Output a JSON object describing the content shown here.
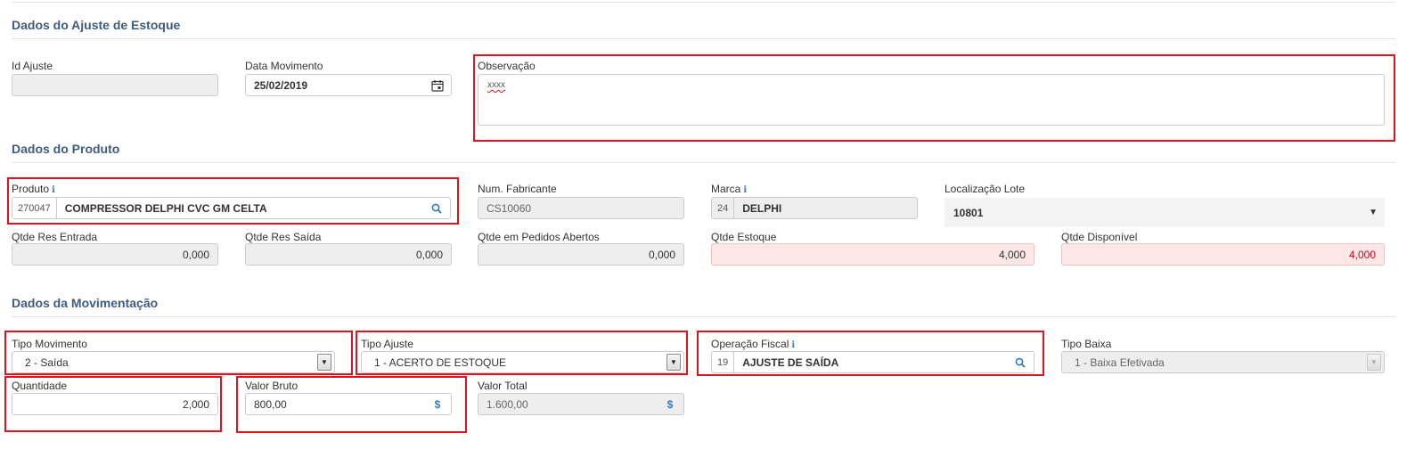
{
  "sections": {
    "ajuste_title": "Dados do Ajuste de Estoque",
    "produto_title": "Dados do Produto",
    "movimentacao_title": "Dados da Movimentação"
  },
  "ajuste": {
    "id_label": "Id Ajuste",
    "id_value": "",
    "data_label": "Data Movimento",
    "data_value": "25/02/2019",
    "obs_label": "Observação",
    "obs_value": "xxxx"
  },
  "produto": {
    "produto_label": "Produto",
    "produto_code": "270047",
    "produto_name": "COMPRESSOR DELPHI CVC GM CELTA",
    "fabricante_label": "Num. Fabricante",
    "fabricante_value": "CS10060",
    "marca_label": "Marca",
    "marca_code": "24",
    "marca_name": "DELPHI",
    "lote_label": "Localização Lote",
    "lote_value": "10801",
    "res_entrada_label": "Qtde Res Entrada",
    "res_entrada_value": "0,000",
    "res_saida_label": "Qtde Res Saída",
    "res_saida_value": "0,000",
    "pedidos_label": "Qtde em Pedidos Abertos",
    "pedidos_value": "0,000",
    "estoque_label": "Qtde Estoque",
    "estoque_value": "4,000",
    "disponivel_label": "Qtde Disponível",
    "disponivel_value": "4,000"
  },
  "movimentacao": {
    "tipo_mov_label": "Tipo Movimento",
    "tipo_mov_value": "2 - Saída",
    "tipo_ajuste_label": "Tipo Ajuste",
    "tipo_ajuste_value": "1 - ACERTO DE ESTOQUE",
    "op_fiscal_label": "Operação Fiscal",
    "op_fiscal_code": "19",
    "op_fiscal_name": "AJUSTE DE SAÍDA",
    "tipo_baixa_label": "Tipo Baixa",
    "tipo_baixa_value": "1 - Baixa Efetivada",
    "quantidade_label": "Quantidade",
    "quantidade_value": "2,000",
    "valor_bruto_label": "Valor Bruto",
    "valor_bruto_value": "800,00",
    "valor_total_label": "Valor Total",
    "valor_total_value": "1.600,00"
  },
  "icons": {
    "info": "i",
    "currency": "$",
    "search": "search-icon",
    "calendar": "calendar-icon",
    "dropdown": "▼"
  },
  "colors": {
    "section_title": "#3f5b80",
    "highlight": "#e0121e",
    "warn_bg": "#fde6e6",
    "accent": "#2f7dc0"
  }
}
